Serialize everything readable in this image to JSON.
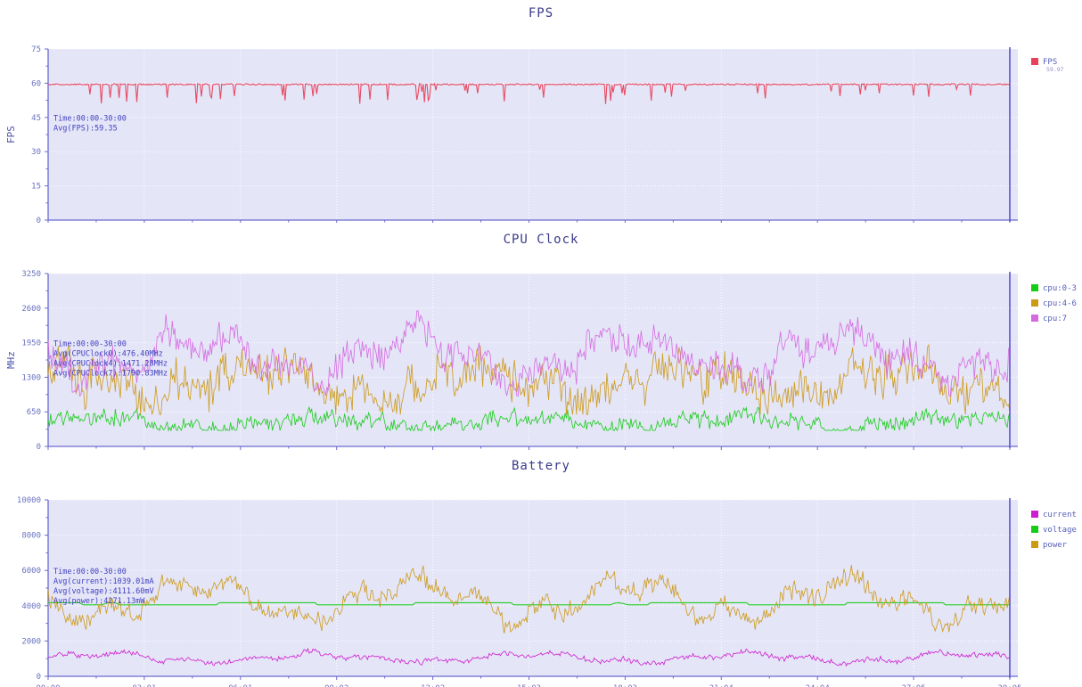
{
  "page": {
    "background": "#ffffff",
    "plot_background": "#e5e5f8",
    "axis_color": "#6a6ad0",
    "grid_color": "#ffffff",
    "text_color": "#5560b8",
    "cursor_line_color": "#5a4fd0"
  },
  "charts": [
    {
      "id": "fps",
      "title": "FPS",
      "ylabel": "FPS",
      "yticks": [
        "0",
        "15",
        "30",
        "45",
        "60",
        "75"
      ],
      "ylim": [
        0,
        75
      ],
      "xticks": [
        "00:00",
        "03:01",
        "06:01",
        "09:02",
        "12:02",
        "15:03",
        "18:03",
        "21:04",
        "24:04",
        "27:05",
        "30:05"
      ],
      "annotation": [
        "Time:00:00-30:00",
        "Avg(FPS):59.35"
      ],
      "legend": [
        {
          "label": "FPS",
          "sub": "59.97",
          "color": "#e8425a"
        }
      ],
      "chart_data": {
        "type": "line",
        "title": "FPS",
        "xlabel": "",
        "ylabel": "FPS",
        "ylim": [
          0,
          75
        ],
        "xlim": [
          "00:00",
          "30:05"
        ],
        "grid": true,
        "legend_position": "right",
        "series": [
          {
            "name": "FPS",
            "color": "#e8425a",
            "mean": 59.35,
            "baseline": 59.8,
            "noise": 0.6,
            "dropouts": 0.09,
            "dropout_depth": 6
          }
        ]
      }
    },
    {
      "id": "cpu",
      "title": "CPU Clock",
      "ylabel": "MHz",
      "yticks": [
        "0",
        "650",
        "1300",
        "1950",
        "2600",
        "3250"
      ],
      "ylim": [
        0,
        3250
      ],
      "xticks": [
        "00:00",
        "03:01",
        "06:01",
        "09:02",
        "12:02",
        "15:03",
        "18:03",
        "21:04",
        "24:04",
        "27:05",
        "30:05"
      ],
      "annotation": [
        "Time:00:00-30:00",
        "Avg(CPUClock0):476.40MHz",
        "Avg(CPUClock4):1471.28MHz",
        "Avg(CPUClock7):1790.83MHz"
      ],
      "legend": [
        {
          "label": "cpu:0-3",
          "sub": "",
          "color": "#17cc17"
        },
        {
          "label": "cpu:4-6",
          "sub": "",
          "color": "#cc9a17"
        },
        {
          "label": "cpu:7",
          "sub": "",
          "color": "#d56ae0"
        }
      ],
      "chart_data": {
        "type": "line",
        "title": "CPU Clock",
        "xlabel": "",
        "ylabel": "MHz",
        "ylim": [
          0,
          3250
        ],
        "xlim": [
          "00:00",
          "30:05"
        ],
        "grid": true,
        "legend_position": "right",
        "series": [
          {
            "name": "cpu:0-3",
            "color": "#17cc17",
            "mean": 476.4,
            "baseline": 430,
            "noise": 340,
            "min": 300,
            "max": 1500
          },
          {
            "name": "cpu:4-6",
            "color": "#cc9a17",
            "mean": 1471.28,
            "baseline": 1150,
            "noise": 900,
            "min": 600,
            "max": 2500
          },
          {
            "name": "cpu:7",
            "color": "#d56ae0",
            "mean": 1790.83,
            "baseline": 1650,
            "noise": 700,
            "min": 950,
            "max": 2550
          }
        ]
      }
    },
    {
      "id": "battery",
      "title": "Battery",
      "ylabel": "",
      "yticks": [
        "0",
        "2000",
        "4000",
        "6000",
        "8000",
        "10000"
      ],
      "ylim": [
        0,
        10000
      ],
      "xticks": [
        "00:00",
        "03:01",
        "06:01",
        "09:02",
        "12:02",
        "15:03",
        "18:03",
        "21:04",
        "24:04",
        "27:05",
        "30:05"
      ],
      "annotation": [
        "Time:00:00-30:00",
        "Avg(current):1039.01mA",
        "Avg(voltage):4111.60mV",
        "Avg(power):4271.13mW"
      ],
      "legend": [
        {
          "label": "current",
          "sub": "",
          "color": "#cc1ecc"
        },
        {
          "label": "voltage",
          "sub": "",
          "color": "#17cc17"
        },
        {
          "label": "power",
          "sub": "",
          "color": "#cc9a17"
        }
      ],
      "chart_data": {
        "type": "line",
        "title": "Battery",
        "xlabel": "",
        "ylabel": "",
        "ylim": [
          0,
          10000
        ],
        "xlim": [
          "00:00",
          "30:05"
        ],
        "grid": true,
        "legend_position": "right",
        "series": [
          {
            "name": "current",
            "color": "#cc1ecc",
            "mean": 1039.01,
            "baseline": 1020,
            "noise": 330,
            "min": 500,
            "max": 2000
          },
          {
            "name": "voltage",
            "color": "#17cc17",
            "mean": 4111.6,
            "baseline": 4111,
            "noise": 30,
            "min": 4050,
            "max": 4170
          },
          {
            "name": "power",
            "color": "#cc9a17",
            "mean": 4271.13,
            "baseline": 4250,
            "noise": 1200,
            "min": 2400,
            "max": 6800
          }
        ]
      }
    }
  ]
}
